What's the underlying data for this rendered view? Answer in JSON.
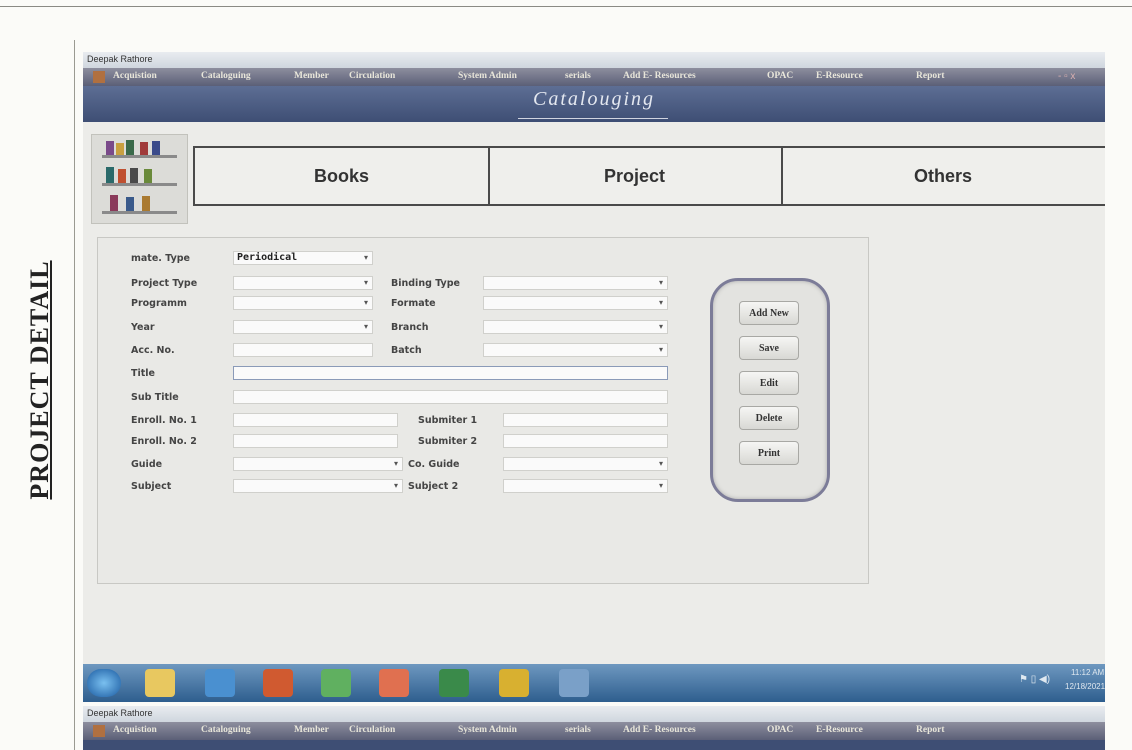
{
  "document": {
    "side_heading": "PROJECT DETAIL"
  },
  "window": {
    "title": "Deepak Rathore",
    "menu": [
      "Acquistion",
      "Cataloguing",
      "Member",
      "Circulation",
      "System Admin",
      "serials",
      "Add E- Resources",
      "OPAC",
      "E-Resource",
      "Report"
    ],
    "controls": "- ▫ x"
  },
  "banner": {
    "title": "Catalouging"
  },
  "tabs": [
    "Books",
    "Project",
    "Others"
  ],
  "form": {
    "mate_type": {
      "label": "mate. Type",
      "value": "Periodical"
    },
    "project_type": {
      "label": "Project Type",
      "value": ""
    },
    "binding_type": {
      "label": "Binding Type",
      "value": ""
    },
    "programm": {
      "label": "Programm",
      "value": ""
    },
    "formate": {
      "label": "Formate",
      "value": ""
    },
    "year": {
      "label": "Year",
      "value": ""
    },
    "branch": {
      "label": "Branch",
      "value": ""
    },
    "acc_no": {
      "label": "Acc. No.",
      "value": ""
    },
    "batch": {
      "label": "Batch",
      "value": ""
    },
    "title": {
      "label": "Title",
      "value": ""
    },
    "sub_title": {
      "label": "Sub Title",
      "value": ""
    },
    "enroll_1": {
      "label": "Enroll. No. 1",
      "value": ""
    },
    "submiter_1": {
      "label": "Submiter 1",
      "value": ""
    },
    "enroll_2": {
      "label": "Enroll. No. 2",
      "value": ""
    },
    "submiter_2": {
      "label": "Submiter 2",
      "value": ""
    },
    "guide": {
      "label": "Guide",
      "value": ""
    },
    "co_guide": {
      "label": "Co. Guide",
      "value": ""
    },
    "subject": {
      "label": "Subject",
      "value": ""
    },
    "subject_2": {
      "label": "Subject 2",
      "value": ""
    },
    "dropdown_arrow": "▾"
  },
  "buttons": {
    "add_new": "Add New",
    "save": "Save",
    "edit": "Edit",
    "delete": "Delete",
    "print": "Print"
  },
  "taskbar": {
    "icons": [
      "start-orb-icon",
      "folder-icon",
      "internet-explorer-icon",
      "media-player-icon",
      "recycle-icon",
      "paint-icon",
      "excel-icon",
      "chrome-icon",
      "form-app-icon"
    ],
    "time": "11:12 AM",
    "date": "12/18/2021"
  },
  "window2": {
    "title": "Deepak Rathore",
    "menu": [
      "Acquistion",
      "Cataloguing",
      "Member",
      "Circulation",
      "System Admin",
      "serials",
      "Add E- Resources",
      "OPAC",
      "E-Resource",
      "Report"
    ]
  },
  "colors": {
    "menubar": "#5b5f77",
    "banner": "#3e4e74",
    "taskbar": "#2e5e8e"
  }
}
